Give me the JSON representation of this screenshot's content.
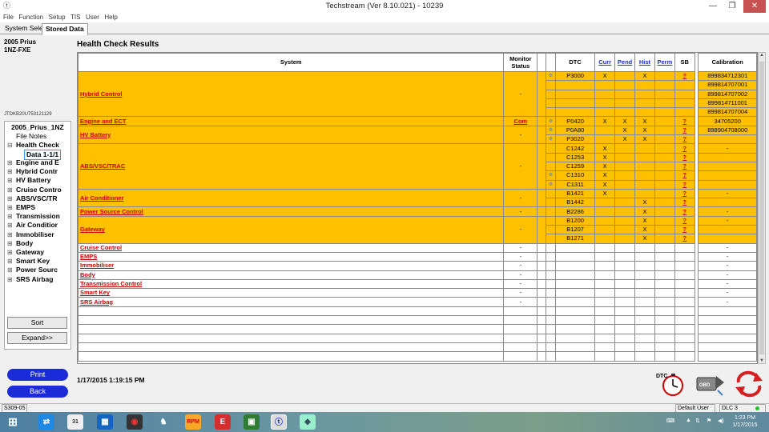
{
  "window": {
    "title": "Techstream (Ver 8.10.021) - 10239",
    "min": "—",
    "max": "❐",
    "close": "✕"
  },
  "menu": [
    "File",
    "Function",
    "Setup",
    "TIS",
    "User",
    "Help"
  ],
  "tabs": [
    "System Select",
    "Stored Data"
  ],
  "vehicle": {
    "model": "2005 Prius",
    "engine": "1NZ-FXE",
    "vin": "JTDKB20U753121129"
  },
  "tree": {
    "root": "2005_Prius_1NZ",
    "file_notes": "File Notes",
    "health": "Health Check",
    "data": "Data 1-1/1",
    "items": [
      "Engine and E",
      "Hybrid Contr",
      "HV Battery",
      "Cruise Contro",
      "ABS/VSC/TR",
      "EMPS",
      "Transmission",
      "Air Conditior",
      "Immobiliser",
      "Body",
      "Gateway",
      "Smart Key",
      "Power Sourc",
      "SRS Airbag"
    ]
  },
  "buttons": {
    "sort": "Sort",
    "expand": "Expand>>",
    "print": "Print",
    "back": "Back"
  },
  "main": {
    "title": "Health Check Results",
    "timestamp": "1/17/2015 1:19:15 PM"
  },
  "table": {
    "headers": {
      "system": "System",
      "monitor": "Monitor Status",
      "dtc": "DTC",
      "curr": "Curr",
      "pend": "Pend",
      "hist": "Hist",
      "perm": "Perm",
      "sb": "SB",
      "calibration": "Calibration"
    },
    "groups": [
      {
        "system": "Hybrid Control",
        "monitor": "-",
        "orange": true,
        "rows": [
          {
            "icon": true,
            "dtc": "P3000",
            "curr": "X",
            "pend": "",
            "hist": "X",
            "perm": "",
            "sb": "?",
            "cal": "899834712301"
          },
          {
            "icon": false,
            "dtc": "",
            "curr": "",
            "pend": "",
            "hist": "",
            "perm": "",
            "sb": "",
            "cal": "899814707001"
          },
          {
            "icon": false,
            "dtc": "",
            "curr": "",
            "pend": "",
            "hist": "",
            "perm": "",
            "sb": "",
            "cal": "899814707002"
          },
          {
            "icon": false,
            "dtc": "",
            "curr": "",
            "pend": "",
            "hist": "",
            "perm": "",
            "sb": "",
            "cal": "899814711001"
          },
          {
            "icon": false,
            "dtc": "",
            "curr": "",
            "pend": "",
            "hist": "",
            "perm": "",
            "sb": "",
            "cal": "899814707004"
          }
        ]
      },
      {
        "system": "Engine and ECT",
        "monitor": "Com",
        "orange": true,
        "rows": [
          {
            "icon": true,
            "dtc": "P0420",
            "curr": "X",
            "pend": "X",
            "hist": "X",
            "perm": "",
            "sb": "?",
            "cal": "34705200"
          }
        ]
      },
      {
        "system": "HV Battery",
        "monitor": "-",
        "orange": true,
        "rows": [
          {
            "icon": true,
            "dtc": "P0A80",
            "curr": "",
            "pend": "X",
            "hist": "X",
            "perm": "",
            "sb": "?",
            "cal": "898904708000"
          },
          {
            "icon": true,
            "dtc": "P3020",
            "curr": "",
            "pend": "X",
            "hist": "X",
            "perm": "",
            "sb": "?",
            "cal": ""
          }
        ]
      },
      {
        "system": "ABS/VSC/TRAC",
        "monitor": "-",
        "orange": true,
        "rows": [
          {
            "icon": false,
            "dtc": "C1242",
            "curr": "X",
            "pend": "",
            "hist": "",
            "perm": "",
            "sb": "?",
            "cal": "-"
          },
          {
            "icon": false,
            "dtc": "C1253",
            "curr": "X",
            "pend": "",
            "hist": "",
            "perm": "",
            "sb": "?",
            "cal": ""
          },
          {
            "icon": false,
            "dtc": "C1259",
            "curr": "X",
            "pend": "",
            "hist": "",
            "perm": "",
            "sb": "?",
            "cal": ""
          },
          {
            "icon": true,
            "dtc": "C1310",
            "curr": "X",
            "pend": "",
            "hist": "",
            "perm": "",
            "sb": "?",
            "cal": ""
          },
          {
            "icon": true,
            "dtc": "C1311",
            "curr": "X",
            "pend": "",
            "hist": "",
            "perm": "",
            "sb": "?",
            "cal": ""
          }
        ]
      },
      {
        "system": "Air Conditioner",
        "monitor": "-",
        "orange": true,
        "rows": [
          {
            "icon": false,
            "dtc": "B1421",
            "curr": "X",
            "pend": "",
            "hist": "",
            "perm": "",
            "sb": "?",
            "cal": "-"
          },
          {
            "icon": false,
            "dtc": "B1442",
            "curr": "",
            "pend": "",
            "hist": "X",
            "perm": "",
            "sb": "?",
            "cal": ""
          }
        ]
      },
      {
        "system": "Power Source Control",
        "monitor": "-",
        "orange": true,
        "rows": [
          {
            "icon": false,
            "dtc": "B2286",
            "curr": "",
            "pend": "",
            "hist": "X",
            "perm": "",
            "sb": "?",
            "cal": "-"
          }
        ]
      },
      {
        "system": "Gateway",
        "monitor": "-",
        "orange": true,
        "rows": [
          {
            "icon": false,
            "dtc": "B1200",
            "curr": "",
            "pend": "",
            "hist": "X",
            "perm": "",
            "sb": "?",
            "cal": "-"
          },
          {
            "icon": false,
            "dtc": "B1207",
            "curr": "",
            "pend": "",
            "hist": "X",
            "perm": "",
            "sb": "?",
            "cal": ""
          },
          {
            "icon": false,
            "dtc": "B1271",
            "curr": "",
            "pend": "",
            "hist": "X",
            "perm": "",
            "sb": "?",
            "cal": ""
          }
        ]
      },
      {
        "system": "Cruise Control",
        "monitor": "-",
        "orange": false,
        "rows": [
          {
            "icon": false,
            "dtc": "",
            "curr": "",
            "pend": "",
            "hist": "",
            "perm": "",
            "sb": "",
            "cal": "-"
          }
        ]
      },
      {
        "system": "EMPS",
        "monitor": "-",
        "orange": false,
        "rows": [
          {
            "icon": false,
            "dtc": "",
            "curr": "",
            "pend": "",
            "hist": "",
            "perm": "",
            "sb": "",
            "cal": "-"
          }
        ]
      },
      {
        "system": "Immobiliser",
        "monitor": "-",
        "orange": false,
        "rows": [
          {
            "icon": false,
            "dtc": "",
            "curr": "",
            "pend": "",
            "hist": "",
            "perm": "",
            "sb": "",
            "cal": "-"
          }
        ]
      },
      {
        "system": "Body",
        "monitor": "-",
        "orange": false,
        "rows": [
          {
            "icon": false,
            "dtc": "",
            "curr": "",
            "pend": "",
            "hist": "",
            "perm": "",
            "sb": "",
            "cal": "-"
          }
        ]
      },
      {
        "system": "Transmission Control",
        "monitor": "-",
        "orange": false,
        "rows": [
          {
            "icon": false,
            "dtc": "",
            "curr": "",
            "pend": "",
            "hist": "",
            "perm": "",
            "sb": "",
            "cal": "-"
          }
        ]
      },
      {
        "system": "Smart Key",
        "monitor": "-",
        "orange": false,
        "rows": [
          {
            "icon": false,
            "dtc": "",
            "curr": "",
            "pend": "",
            "hist": "",
            "perm": "",
            "sb": "",
            "cal": "-"
          }
        ]
      },
      {
        "system": "SRS Airbag",
        "monitor": "-",
        "orange": false,
        "rows": [
          {
            "icon": false,
            "dtc": "",
            "curr": "",
            "pend": "",
            "hist": "",
            "perm": "",
            "sb": "",
            "cal": "-"
          }
        ]
      }
    ],
    "empty_rows": 6
  },
  "statusbar": {
    "code": "S309-05",
    "user": "Default User",
    "dlc": "DLC 3"
  },
  "icons": {
    "dtc_timer": "DTC",
    "obd": "OBD",
    "refresh": "refresh"
  },
  "taskbar": {
    "time": "1:23 PM",
    "date": "1/17/2015",
    "calendar_day": "31"
  },
  "colors": {
    "orange": "#ffc000",
    "link_red": "#cc0000",
    "blue_button": "#1b2bd9"
  }
}
